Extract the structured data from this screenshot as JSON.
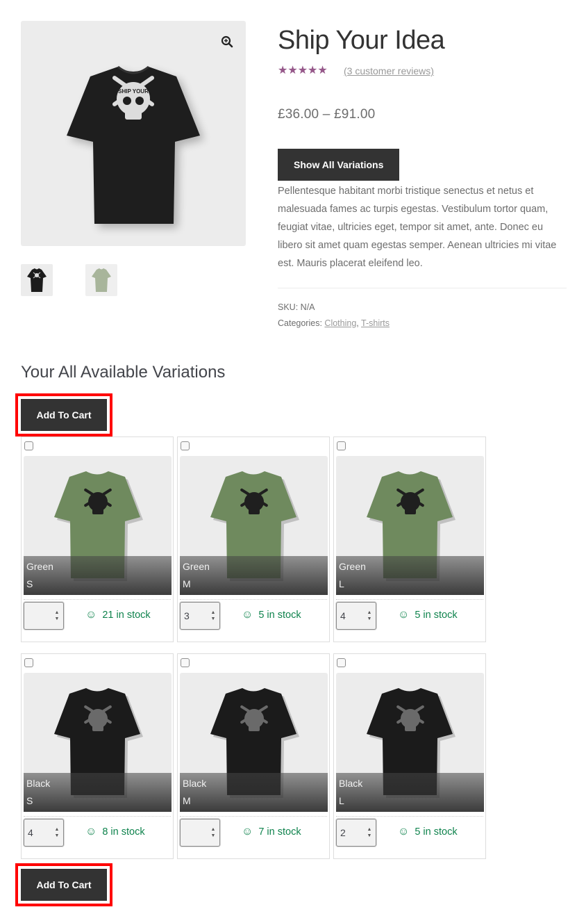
{
  "product": {
    "title": "Ship Your Idea",
    "rating": {
      "value": 4.33,
      "max": 5,
      "stars_glyph": "★★★★★",
      "review_link": "(3 customer reviews)"
    },
    "price": "£36.00 – £91.00",
    "show_variations_label": "Show All Variations",
    "description": "Pellentesque habitant morbi tristique senectus et netus et malesuada fames ac turpis egestas. Vestibulum tortor quam, feugiat vitae, ultricies eget, tempor sit amet, ante. Donec eu libero sit amet quam egestas semper. Aenean ultricies mi vitae est. Mauris placerat eleifend leo.",
    "meta": {
      "sku_label": "SKU:",
      "sku_value": "N/A",
      "categories_label": "Categories:",
      "categories": [
        "Clothing",
        "T-shirts"
      ],
      "separator": ","
    }
  },
  "gallery": {
    "zoom_icon": "magnifier-plus-icon",
    "main_image": "black t-shirt with skull 'Ship Your Idea' print",
    "thumbnails": [
      {
        "alt": "black t-shirt thumbnail"
      },
      {
        "alt": "green t-shirt thumbnail"
      }
    ]
  },
  "variations": {
    "heading": "Your All Available Variations",
    "add_to_cart_label": "Add To Cart",
    "stock_icon": "smiley-icon",
    "items": [
      {
        "color": "Green",
        "size": "S",
        "qty": "",
        "stock": "21 in stock",
        "shirt": "#6f8a5e",
        "print": "#1f1f1f"
      },
      {
        "color": "Green",
        "size": "M",
        "qty": "3",
        "stock": "5 in stock",
        "shirt": "#6f8a5e",
        "print": "#1f1f1f"
      },
      {
        "color": "Green",
        "size": "L",
        "qty": "4",
        "stock": "5 in stock",
        "shirt": "#6f8a5e",
        "print": "#1f1f1f"
      },
      {
        "color": "Black",
        "size": "S",
        "qty": "4",
        "stock": "8 in stock",
        "shirt": "#1b1b1b",
        "print": "#6a6a6a"
      },
      {
        "color": "Black",
        "size": "M",
        "qty": "",
        "stock": "7 in stock",
        "shirt": "#1b1b1b",
        "print": "#6a6a6a"
      },
      {
        "color": "Black",
        "size": "L",
        "qty": "2",
        "stock": "5 in stock",
        "shirt": "#1b1b1b",
        "print": "#6a6a6a"
      }
    ]
  },
  "colors": {
    "accent_star": "#96588a",
    "button_bg": "#333333",
    "highlight": "#ff0000",
    "in_stock": "#0f834d"
  }
}
